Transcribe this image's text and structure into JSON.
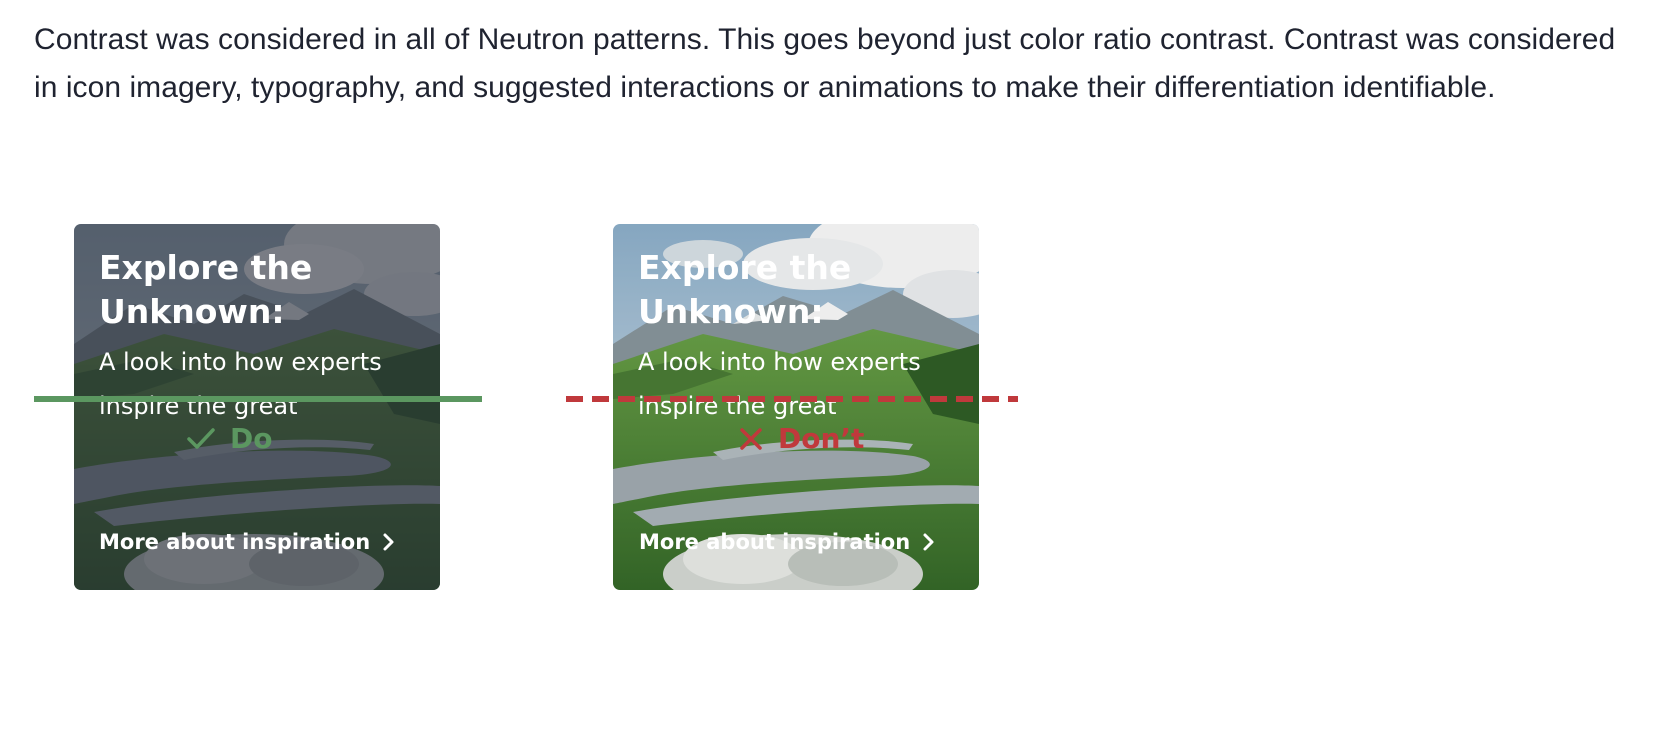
{
  "intro": {
    "text": "Contrast was considered in all of Neutron patterns. This goes beyond just color ratio contrast. Contrast was considered in icon imagery, typography, and suggested interactions or animations to make their differentiation identifiable."
  },
  "examples": [
    {
      "variant": "do",
      "card": {
        "title": "Explore the Unknown:",
        "subtitle": "A look into how experts inspire the great",
        "link_label": "More about inspiration",
        "link_icon": "chevron-right-icon"
      },
      "verdict": {
        "label": "Do",
        "icon": "checkmark-icon",
        "color": "#5b9760"
      }
    },
    {
      "variant": "dont",
      "card": {
        "title": "Explore the Unknown:",
        "subtitle": "A look into how experts inspire the great",
        "link_label": "More about inspiration",
        "link_icon": "chevron-right-icon"
      },
      "verdict": {
        "label": "Don’t",
        "icon": "cross-icon",
        "color": "#c0393c"
      }
    }
  ]
}
